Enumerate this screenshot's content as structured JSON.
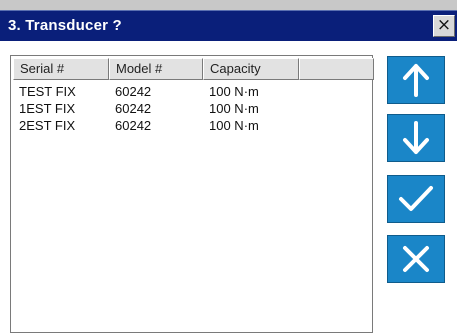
{
  "dialog": {
    "title": "3. Transducer ?",
    "close_glyph": "×"
  },
  "table": {
    "columns": [
      "Serial #",
      "Model #",
      "Capacity",
      ""
    ],
    "rows": [
      [
        "TEST FIX",
        "60242",
        "100 N·m"
      ],
      [
        "1EST FIX",
        "60242",
        "100 N·m"
      ],
      [
        "2EST FIX",
        "60242",
        "100 N·m"
      ]
    ]
  },
  "buttons": [
    {
      "name": "up-button",
      "icon": "arrow-up-icon"
    },
    {
      "name": "down-button",
      "icon": "arrow-down-icon"
    },
    {
      "name": "confirm-button",
      "icon": "check-icon"
    },
    {
      "name": "cancel-button",
      "icon": "x-icon"
    }
  ],
  "colors": {
    "titlebar": "#0a1f7a",
    "button": "#1a86c8",
    "icon": "#ffffff"
  }
}
